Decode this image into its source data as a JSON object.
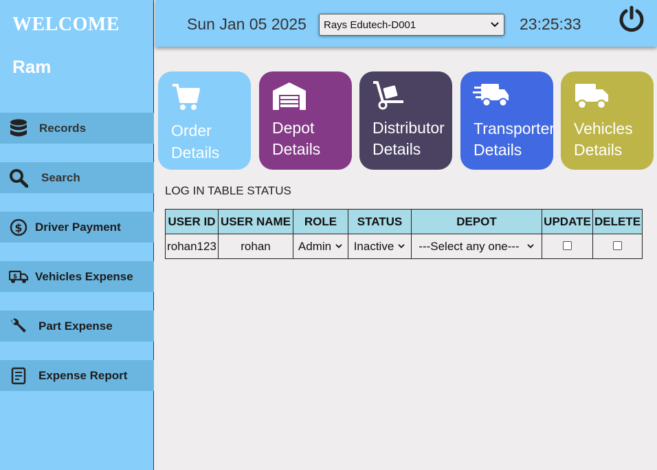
{
  "sidebar": {
    "welcome": "WELCOME",
    "user_name": "Ram",
    "items": [
      {
        "label": "Records",
        "icon": "database-icon"
      },
      {
        "label": "Search",
        "icon": "search-icon"
      },
      {
        "label": "Driver Payment",
        "icon": "dollar-coin-icon"
      },
      {
        "label": "Vehicles Expense",
        "icon": "truck-money-icon"
      },
      {
        "label": "Part Expense",
        "icon": "wrench-icon"
      },
      {
        "label": "Expense Report",
        "icon": "report-icon"
      }
    ]
  },
  "header": {
    "date": "Sun Jan 05 2025",
    "site_select": "Rays Edutech-D001",
    "time": "23:25:33",
    "power_icon": "power-icon"
  },
  "cards": [
    {
      "line1": "Order",
      "line2": "Details",
      "color": "#87cefa",
      "icon": "cart-icon"
    },
    {
      "line1": "Depot",
      "line2": "Details",
      "color": "#843a86",
      "icon": "warehouse-icon"
    },
    {
      "line1": "Distributor",
      "line2": "Details",
      "color": "#4a4260",
      "icon": "hand-truck-icon"
    },
    {
      "line1": "Transporter",
      "line2": "Details",
      "color": "#4169e1",
      "icon": "fast-truck-icon"
    },
    {
      "line1": "Vehicles",
      "line2": "Details",
      "color": "#bdb548",
      "icon": "truck-icon"
    }
  ],
  "status": {
    "title": "LOG IN TABLE STATUS",
    "columns": [
      "USER ID",
      "USER NAME",
      "ROLE",
      "STATUS",
      "DEPOT",
      "UPDATE",
      "DELETE"
    ],
    "rows": [
      {
        "user_id": "rohan123",
        "user_name": "rohan",
        "role": "Admin",
        "status": "Inactive",
        "depot": "---Select any one---",
        "update": false,
        "delete": false
      }
    ]
  },
  "colors": {
    "sidebar_bg": "#87cefa",
    "nav_item_bg": "#6bb6e0",
    "page_bg": "#efeded",
    "table_header_bg": "#a8dbe8"
  }
}
